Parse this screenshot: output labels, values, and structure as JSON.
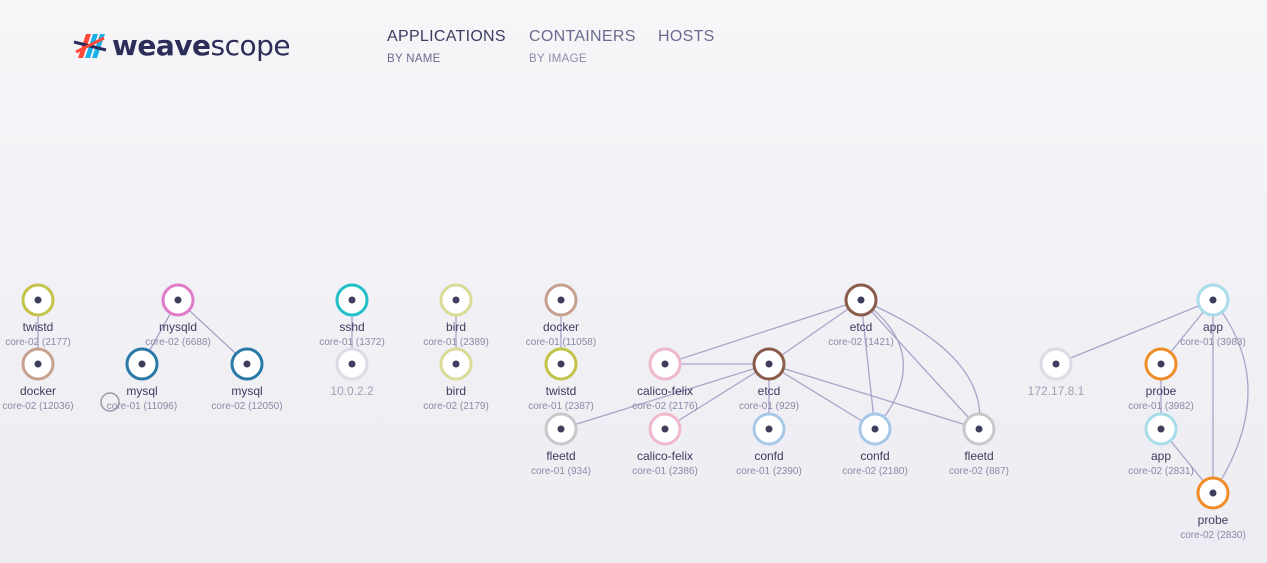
{
  "app": {
    "brand_weave": "weave",
    "brand_scope": "scope"
  },
  "topologies": [
    {
      "label": "APPLICATIONS",
      "sublabel": "BY NAME",
      "active": true
    },
    {
      "label": "CONTAINERS",
      "sublabel": "BY IMAGE",
      "active": false
    },
    {
      "label": "HOSTS",
      "sublabel": "",
      "active": false
    }
  ],
  "colors": {
    "edge": "#a8a6c8",
    "node_center": "#3d3d5c",
    "logo_red": "#ff4a3a",
    "logo_blue": "#1ab0e8",
    "logo_navy": "#2d2d5a"
  },
  "nodes": [
    {
      "id": "twistd_a",
      "label": "twistd",
      "sub": "core-02 (2177)",
      "color": "#c3c34a"
    },
    {
      "id": "docker_a",
      "label": "docker",
      "sub": "core-02 (12036)",
      "color": "#c8a090"
    },
    {
      "id": "mysqld",
      "label": "mysqld",
      "sub": "core-02 (6688)",
      "color": "#e07bc8"
    },
    {
      "id": "mysql_a",
      "label": "mysql",
      "sub": "core-01 (11096)",
      "color": "#2a78a8"
    },
    {
      "id": "mysql_b",
      "label": "mysql",
      "sub": "core-02 (12050)",
      "color": "#2a78a8"
    },
    {
      "id": "sshd",
      "label": "sshd",
      "sub": "core-01 (1372)",
      "color": "#22bfc8"
    },
    {
      "id": "ip_10",
      "label": "10.0.2.2",
      "sub": "",
      "color": "#dcdce6",
      "dim": true
    },
    {
      "id": "bird_a",
      "label": "bird",
      "sub": "core-01 (2389)",
      "color": "#d8dc98"
    },
    {
      "id": "bird_b",
      "label": "bird",
      "sub": "core-02 (2179)",
      "color": "#d8dc98"
    },
    {
      "id": "docker_b",
      "label": "docker",
      "sub": "core-01 (11058)",
      "color": "#c8a090"
    },
    {
      "id": "twistd_b",
      "label": "twistd",
      "sub": "core-01 (2387)",
      "color": "#c3c34a"
    },
    {
      "id": "fleetd_a",
      "label": "fleetd",
      "sub": "core-01 (934)",
      "color": "#c8c8cc"
    },
    {
      "id": "calico_a",
      "label": "calico-felix",
      "sub": "core-02 (2176)",
      "color": "#f0b8cc"
    },
    {
      "id": "calico_b",
      "label": "calico-felix",
      "sub": "core-01 (2386)",
      "color": "#f0b8cc"
    },
    {
      "id": "etcd_a",
      "label": "etcd",
      "sub": "core-02 (1421)",
      "color": "#8a5a4a"
    },
    {
      "id": "etcd_b",
      "label": "etcd",
      "sub": "core-01 (929)",
      "color": "#8a5a4a"
    },
    {
      "id": "confd_a",
      "label": "confd",
      "sub": "core-01 (2390)",
      "color": "#a8c8e8"
    },
    {
      "id": "confd_b",
      "label": "confd",
      "sub": "core-02 (2180)",
      "color": "#a8c8e8"
    },
    {
      "id": "fleetd_b",
      "label": "fleetd",
      "sub": "core-02 (887)",
      "color": "#c8c8cc"
    },
    {
      "id": "ip_172",
      "label": "172.17.8.1",
      "sub": "",
      "color": "#dcdce6",
      "dim": true
    },
    {
      "id": "app_a",
      "label": "app",
      "sub": "core-01 (3983)",
      "color": "#a8dce8"
    },
    {
      "id": "probe_a",
      "label": "probe",
      "sub": "core-01 (3982)",
      "color": "#f08c28"
    },
    {
      "id": "app_b",
      "label": "app",
      "sub": "core-02 (2831)",
      "color": "#a8dce8"
    },
    {
      "id": "probe_b",
      "label": "probe",
      "sub": "core-02 (2830)",
      "color": "#f08c28"
    }
  ],
  "edges": [
    [
      "twistd_a",
      "docker_a"
    ],
    [
      "mysqld",
      "mysql_a"
    ],
    [
      "mysqld",
      "mysql_b"
    ],
    [
      "sshd",
      "ip_10"
    ],
    [
      "bird_a",
      "bird_b"
    ],
    [
      "docker_b",
      "twistd_b"
    ],
    [
      "etcd_a",
      "calico_a"
    ],
    [
      "etcd_a",
      "etcd_b"
    ],
    [
      "etcd_a",
      "confd_b"
    ],
    [
      "etcd_a",
      "fleetd_b"
    ],
    [
      "etcd_b",
      "calico_a"
    ],
    [
      "etcd_b",
      "fleetd_a"
    ],
    [
      "etcd_b",
      "calico_b"
    ],
    [
      "etcd_b",
      "confd_a"
    ],
    [
      "etcd_b",
      "confd_b"
    ],
    [
      "etcd_b",
      "fleetd_b"
    ],
    [
      "etcd_a",
      "fleetd_b",
      "curve"
    ],
    [
      "etcd_a",
      "confd_b",
      "curve"
    ],
    [
      "app_a",
      "ip_172"
    ],
    [
      "app_a",
      "probe_a"
    ],
    [
      "app_a",
      "probe_b"
    ],
    [
      "app_a",
      "probe_b",
      "curve"
    ],
    [
      "probe_a",
      "app_b"
    ],
    [
      "app_b",
      "probe_b"
    ]
  ]
}
